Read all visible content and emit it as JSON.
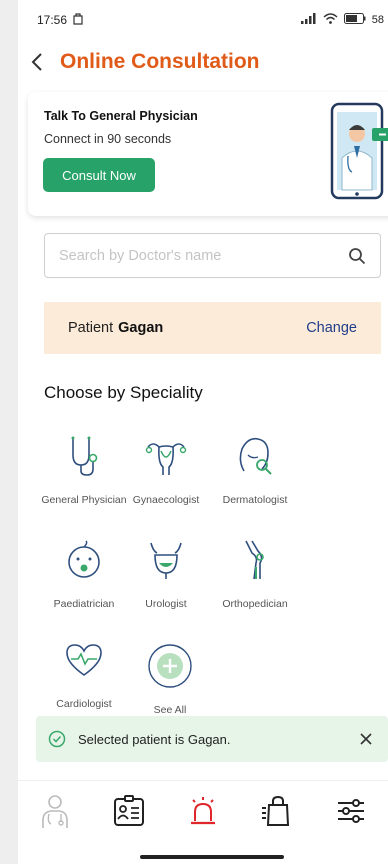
{
  "status_bar": {
    "time": "17:56",
    "battery": "58"
  },
  "header": {
    "title": "Online Consultation"
  },
  "consult_card": {
    "title": "Talk To General Physician",
    "subtitle": "Connect in 90 seconds",
    "button_label": "Consult Now"
  },
  "search": {
    "placeholder": "Search by Doctor's name"
  },
  "patient": {
    "label": "Patient",
    "name": "Gagan",
    "change_label": "Change"
  },
  "specialities": {
    "title": "Choose by Speciality",
    "items": [
      {
        "label": "General Physician",
        "icon": "stethoscope-icon"
      },
      {
        "label": "Gynaecologist",
        "icon": "uterus-icon"
      },
      {
        "label": "Dermatologist",
        "icon": "face-magnifier-icon"
      },
      {
        "label": "Paediatrician",
        "icon": "baby-face-icon"
      },
      {
        "label": "Urologist",
        "icon": "bladder-icon"
      },
      {
        "label": "Orthopedician",
        "icon": "knee-joint-icon"
      },
      {
        "label": "Cardiologist",
        "icon": "heart-pulse-icon"
      },
      {
        "label": "See All",
        "icon": "plus-circle-icon"
      }
    ]
  },
  "toast": {
    "message": "Selected patient is Gagan."
  },
  "bottom_nav": [
    {
      "icon": "doctor-icon"
    },
    {
      "icon": "id-card-icon"
    },
    {
      "icon": "emergency-siren-icon"
    },
    {
      "icon": "shopping-bag-icon"
    },
    {
      "icon": "settings-sliders-icon"
    }
  ],
  "colors": {
    "accent": "#e05a18",
    "primary_button": "#27a36a",
    "patient_bar_bg": "#fdebd9",
    "link": "#1f3d8a",
    "toast_bg": "#e7f4e8",
    "emergency": "#e0262b"
  }
}
